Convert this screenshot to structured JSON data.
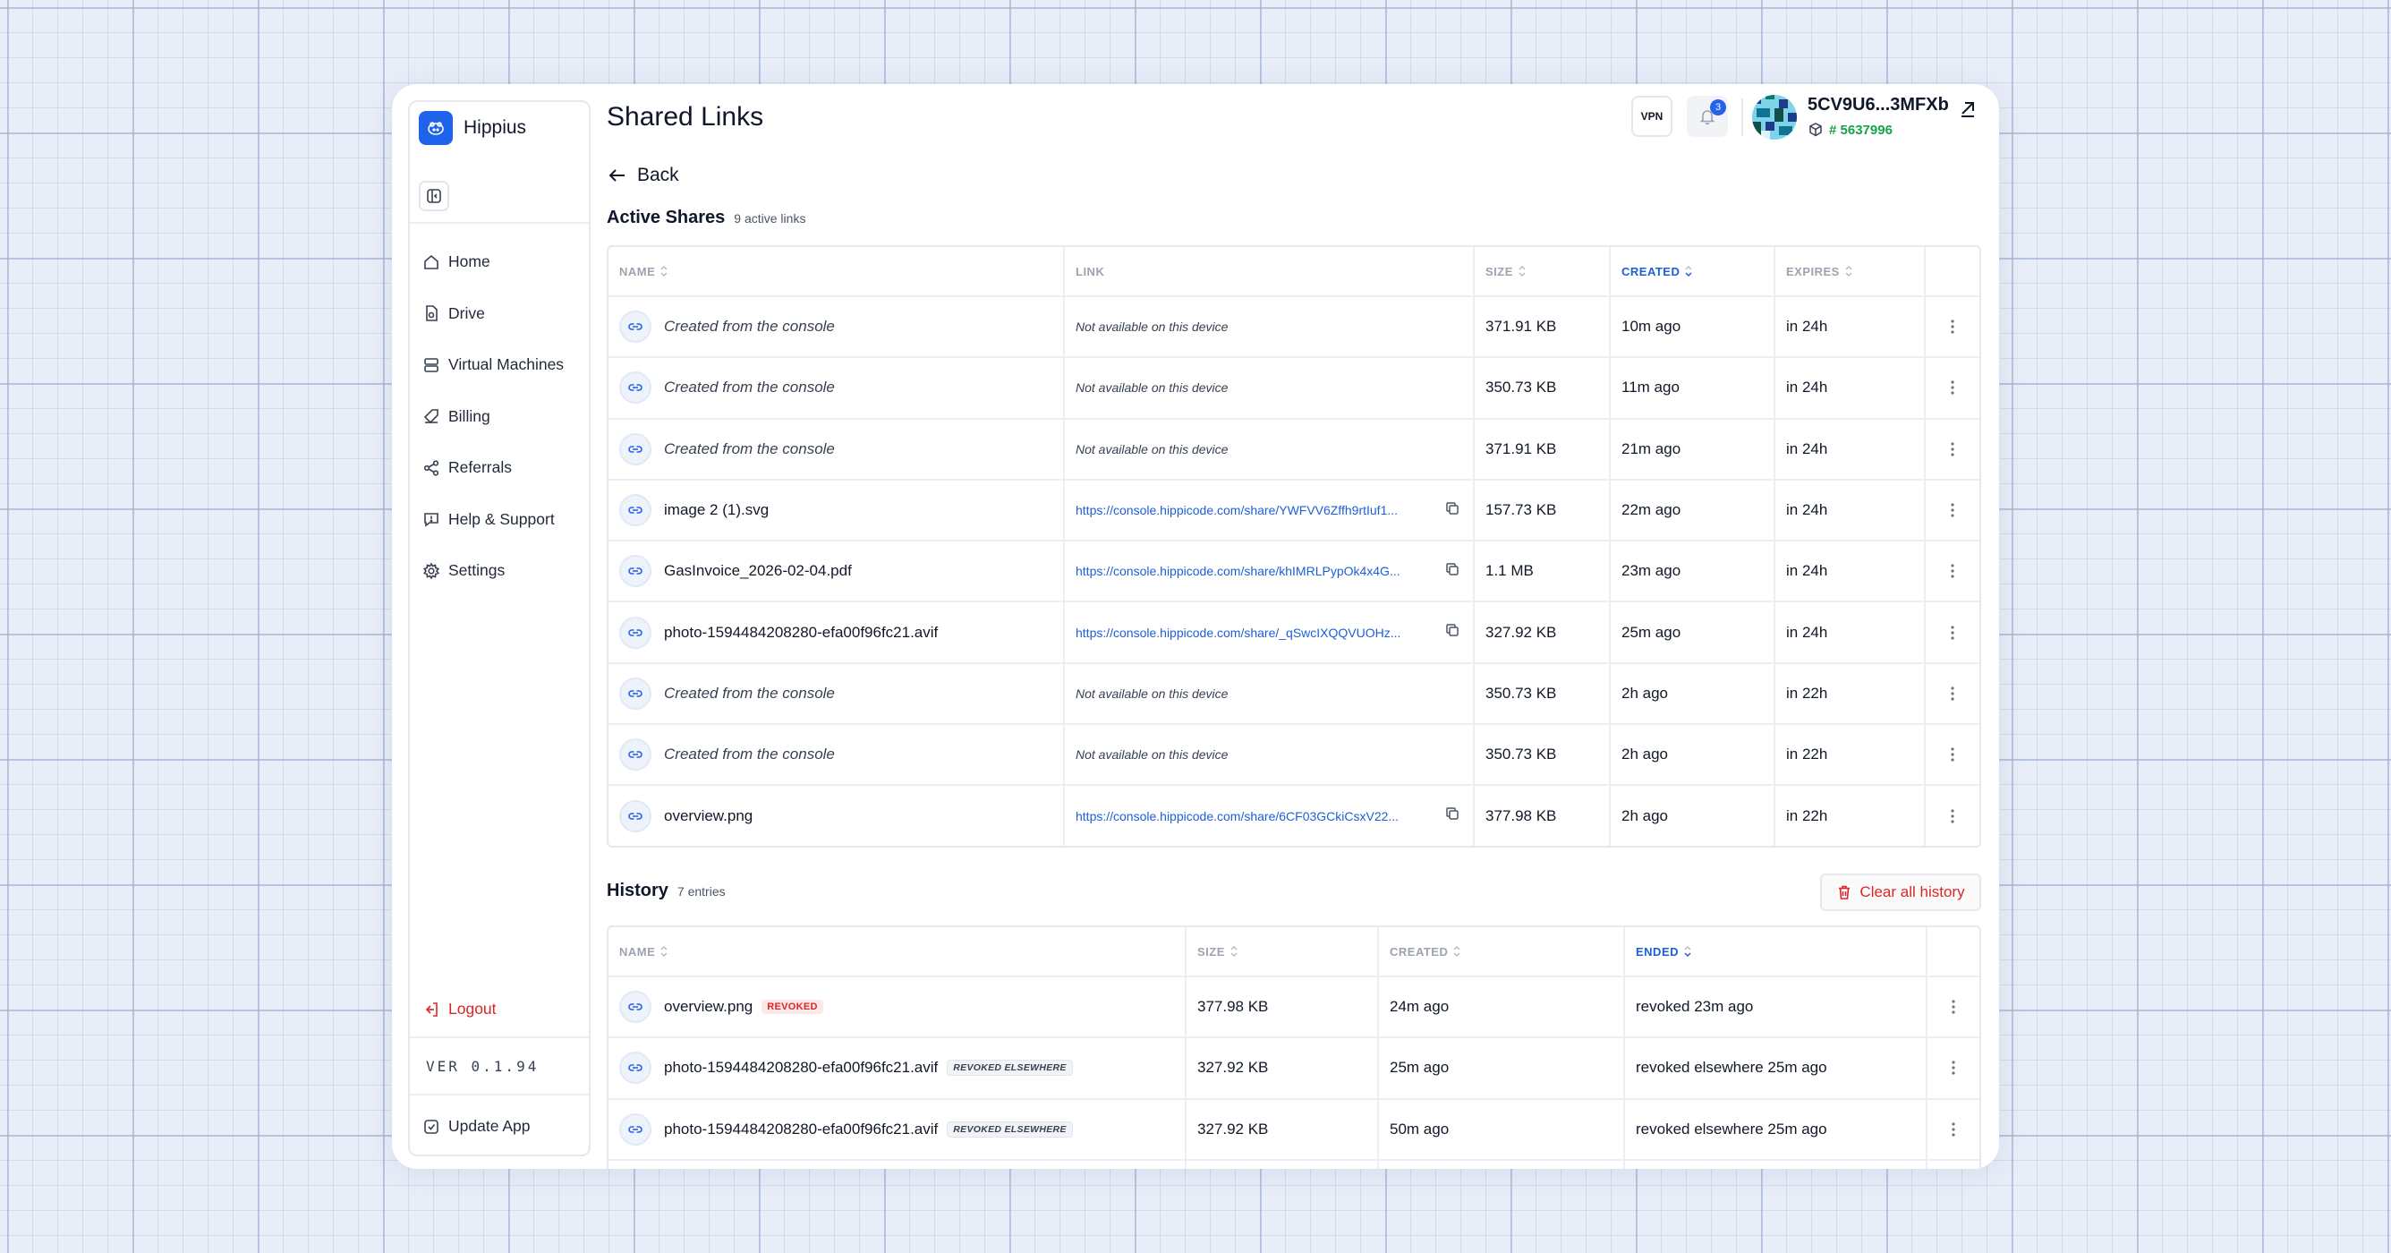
{
  "app": {
    "name": "Hippius",
    "version": "VER 0.1.94"
  },
  "sidebar": {
    "items": [
      {
        "label": "Home",
        "icon": "home-icon"
      },
      {
        "label": "Drive",
        "icon": "drive-icon"
      },
      {
        "label": "Virtual Machines",
        "icon": "server-icon"
      },
      {
        "label": "Billing",
        "icon": "billing-icon"
      },
      {
        "label": "Referrals",
        "icon": "share-icon"
      },
      {
        "label": "Help & Support",
        "icon": "help-icon"
      },
      {
        "label": "Settings",
        "icon": "gear-icon"
      }
    ],
    "logout": "Logout",
    "update": "Update App"
  },
  "header": {
    "title": "Shared Links",
    "vpn": "VPN",
    "notifications": "3",
    "account_name": "5CV9U6...3MFXb",
    "account_id": "# 5637996"
  },
  "back": "Back",
  "active": {
    "title": "Active Shares",
    "subtitle": "9 active links",
    "columns": [
      "NAME",
      "LINK",
      "SIZE",
      "CREATED",
      "EXPIRES"
    ],
    "rows": [
      {
        "name": "Created from the console",
        "link": "Not available on this device",
        "size": "371.91 KB",
        "created": "10m ago",
        "expires": "in 24h"
      },
      {
        "name": "Created from the console",
        "link": "Not available on this device",
        "size": "350.73 KB",
        "created": "11m ago",
        "expires": "in 24h"
      },
      {
        "name": "Created from the console",
        "link": "Not available on this device",
        "size": "371.91 KB",
        "created": "21m ago",
        "expires": "in 24h"
      },
      {
        "name": "image 2 (1).svg",
        "link": "https://console.hippicode.com/share/YWFVV6Zffh9rtIuf1...",
        "size": "157.73 KB",
        "created": "22m ago",
        "expires": "in 24h"
      },
      {
        "name": "GasInvoice_2026-02-04.pdf",
        "link": "https://console.hippicode.com/share/khIMRLPypOk4x4G...",
        "size": "1.1 MB",
        "created": "23m ago",
        "expires": "in 24h"
      },
      {
        "name": "photo-1594484208280-efa00f96fc21.avif",
        "link": "https://console.hippicode.com/share/_qSwcIXQQVUOHz...",
        "size": "327.92 KB",
        "created": "25m ago",
        "expires": "in 24h"
      },
      {
        "name": "Created from the console",
        "link": "Not available on this device",
        "size": "350.73 KB",
        "created": "2h ago",
        "expires": "in 22h"
      },
      {
        "name": "Created from the console",
        "link": "Not available on this device",
        "size": "350.73 KB",
        "created": "2h ago",
        "expires": "in 22h"
      },
      {
        "name": "overview.png",
        "link": "https://console.hippicode.com/share/6CF03GCkiCsxV22...",
        "size": "377.98 KB",
        "created": "2h ago",
        "expires": "in 22h"
      }
    ]
  },
  "history": {
    "title": "History",
    "subtitle": "7 entries",
    "clear_label": "Clear all history",
    "columns": [
      "NAME",
      "SIZE",
      "CREATED",
      "ENDED"
    ],
    "rows": [
      {
        "name": "overview.png",
        "badge": "REVOKED",
        "size": "377.98 KB",
        "created": "24m ago",
        "ended": "revoked 23m ago"
      },
      {
        "name": "photo-1594484208280-efa00f96fc21.avif",
        "badge": "REVOKED ELSEWHERE",
        "size": "327.92 KB",
        "created": "25m ago",
        "ended": "revoked elsewhere 25m ago"
      },
      {
        "name": "photo-1594484208280-efa00f96fc21.avif",
        "badge": "REVOKED ELSEWHERE",
        "size": "327.92 KB",
        "created": "50m ago",
        "ended": "revoked elsewhere 25m ago"
      }
    ]
  },
  "colors": {
    "accent": "#1e63e9",
    "danger": "#dc2626",
    "success": "#16a34a"
  }
}
